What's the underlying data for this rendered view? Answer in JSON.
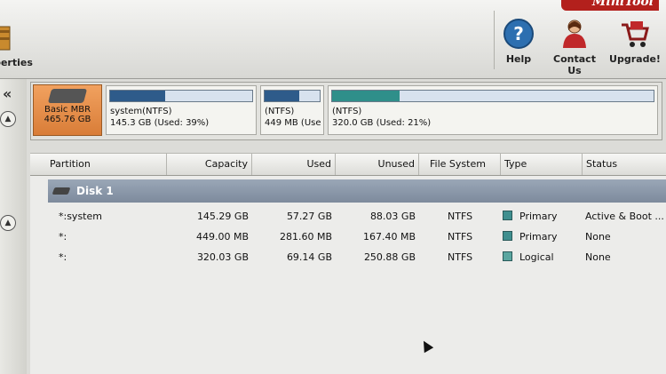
{
  "toolbar": {
    "properties_label": "perties",
    "help_label": "Help",
    "contact_label": "Contact Us",
    "upgrade_label": "Upgrade!"
  },
  "rail": {
    "collapse_glyph": "«"
  },
  "disk_map": {
    "disk_type": "Basic MBR",
    "disk_size": "465.76 GB",
    "partitions": [
      {
        "name": "system(NTFS)",
        "detail": "145.3 GB (Used: 39%)",
        "used_fraction": 0.39
      },
      {
        "name": "(NTFS)",
        "detail": "449 MB (Use",
        "used_fraction": 0.63
      },
      {
        "name": "(NTFS)",
        "detail": "320.0 GB (Used: 21%)",
        "used_fraction": 0.21
      }
    ]
  },
  "table": {
    "headers": {
      "partition": "Partition",
      "capacity": "Capacity",
      "used": "Used",
      "unused": "Unused",
      "filesystem": "File System",
      "type": "Type",
      "status": "Status"
    },
    "disk_label": "Disk 1",
    "rows": [
      {
        "partition": "*:system",
        "capacity": "145.29 GB",
        "used": "57.27 GB",
        "unused": "88.03 GB",
        "filesystem": "NTFS",
        "type": "Primary",
        "status": "Active & Boot ..."
      },
      {
        "partition": "*:",
        "capacity": "449.00 MB",
        "used": "281.60 MB",
        "unused": "167.40 MB",
        "filesystem": "NTFS",
        "type": "Primary",
        "status": "None"
      },
      {
        "partition": "*:",
        "capacity": "320.03 GB",
        "used": "69.14 GB",
        "unused": "250.88 GB",
        "filesystem": "NTFS",
        "type": "Logical",
        "status": "None"
      }
    ]
  },
  "colors": {
    "primary_swatch": "#3f8f8f",
    "logical_swatch": "#5aa6a0",
    "used_bar_1": "#2e5b8a",
    "used_bar_3": "#2f8f8a",
    "disk_info_bg": "#e08a45"
  }
}
